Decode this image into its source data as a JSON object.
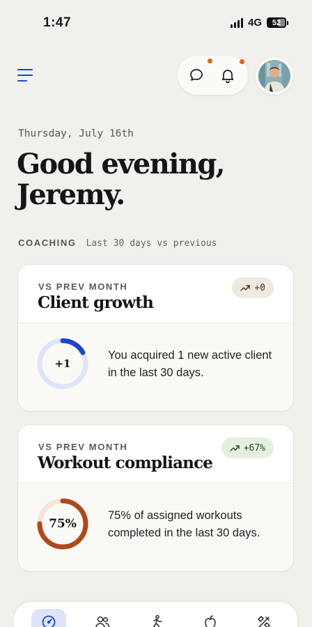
{
  "status": {
    "time": "1:47",
    "network": "4G",
    "battery": "52"
  },
  "header": {
    "menu_icon": "menu-icon",
    "messages_icon": "chat-bubble-icon",
    "notifications_icon": "bell-icon",
    "badge_color": "#e55b26",
    "accent": "#1f44c9"
  },
  "greeting": {
    "date": "Thursday, July 16th",
    "line1": "Good evening,",
    "line2": "Jeremy."
  },
  "section": {
    "title": "COACHING",
    "subtitle": "Last 30 days vs previous"
  },
  "cards": [
    {
      "kicker": "VS PREV MONTH",
      "title": "Client growth",
      "badge": "+0",
      "badge_icon": "trend-up-icon",
      "ring_label": "+1",
      "ring_progress": 0.17,
      "ring_color": "#1f44c9",
      "ring_track": "#dfe5f8",
      "text": "You acquired 1 new active client in the last 30 days."
    },
    {
      "kicker": "VS PREV MONTH",
      "title": "Workout compliance",
      "badge": "+67%",
      "badge_icon": "trend-up-icon",
      "ring_label": "75%",
      "ring_progress": 0.75,
      "ring_color": "#b0481f",
      "ring_track": "#f7e3d9",
      "text": "75% of assigned workouts completed in the last 30 days."
    }
  ],
  "nav": {
    "items": [
      "dashboard-icon",
      "clients-icon",
      "workouts-icon",
      "nutrition-icon",
      "tools-icon"
    ],
    "active_index": 0
  }
}
